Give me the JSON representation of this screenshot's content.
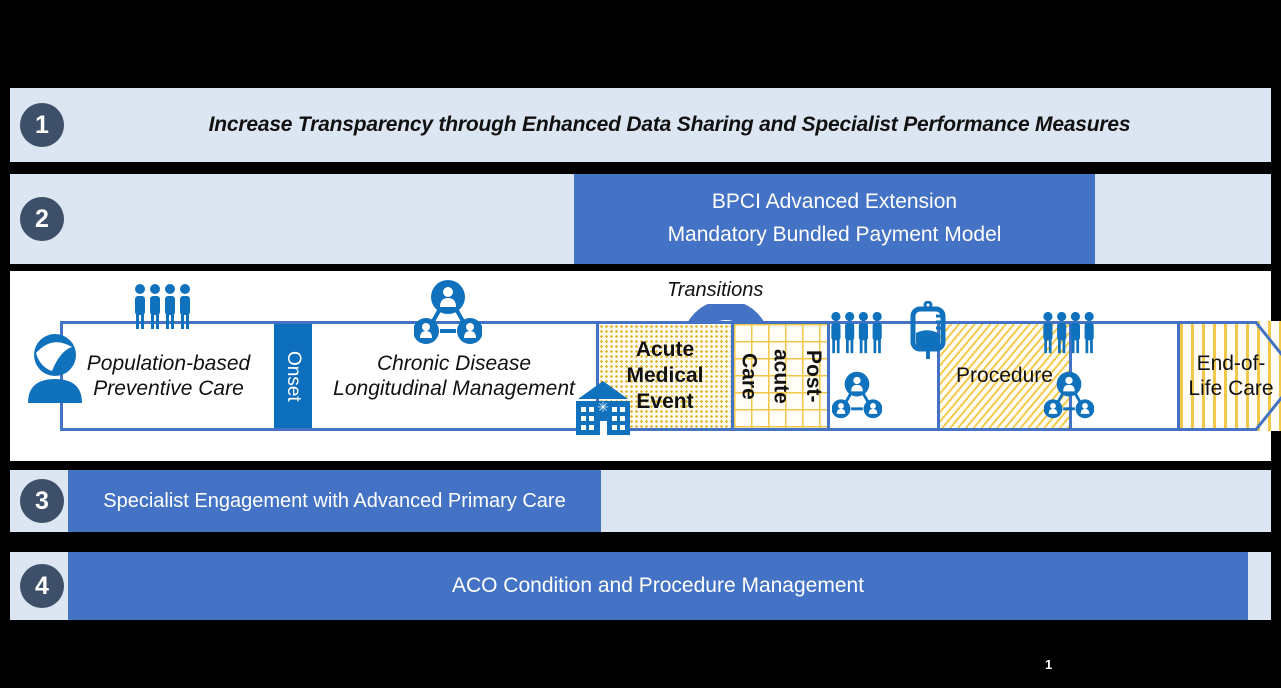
{
  "rows": [
    {
      "number": "1",
      "label": "Increase Transparency through Enhanced Data Sharing and Specialist Performance Measures"
    },
    {
      "number": "2",
      "line1": "BPCI Advanced Extension",
      "line2": "Mandatory Bundled Payment Model"
    },
    {
      "number": "3",
      "label": "Specialist Engagement with Advanced Primary Care"
    },
    {
      "number": "4",
      "label": "ACO Condition and Procedure Management"
    }
  ],
  "continuum": {
    "transitions_label": "Transitions",
    "segments": [
      {
        "id": "population",
        "label_line1": "Population-based",
        "label_line2": "Preventive Care"
      },
      {
        "id": "onset",
        "label": "Onset"
      },
      {
        "id": "chronic",
        "label_line1": "Chronic Disease",
        "label_line2": "Longitudinal Management"
      },
      {
        "id": "acute",
        "label_line1": "Acute",
        "label_line2": "Medical",
        "label_line3": "Event"
      },
      {
        "id": "postacute",
        "label_part1": "Care",
        "label_part2": "acute",
        "label_part3": "Post-"
      },
      {
        "id": "gap1",
        "label": ""
      },
      {
        "id": "procedure",
        "label": "Procedure"
      },
      {
        "id": "gap2",
        "label": ""
      },
      {
        "id": "endoflife",
        "label_line1": "End-of-",
        "label_line2": "Life Care"
      }
    ],
    "icons": [
      {
        "name": "patient-avatar-icon"
      },
      {
        "name": "group-of-people-icon"
      },
      {
        "name": "care-team-network-icon"
      },
      {
        "name": "hospital-building-icon"
      },
      {
        "name": "transitions-arc-arrow-icon"
      },
      {
        "name": "iv-bag-icon"
      }
    ]
  },
  "page": {
    "number": "1"
  },
  "colors": {
    "band_background": "#dce6f2",
    "badge_fill": "#3d4f69",
    "blue_block": "#4472c4",
    "onset_blue": "#0d6ebd",
    "icon_blue": "#1072bd",
    "outline_blue": "#4472c4",
    "gold_pattern": "#f0c74a"
  }
}
